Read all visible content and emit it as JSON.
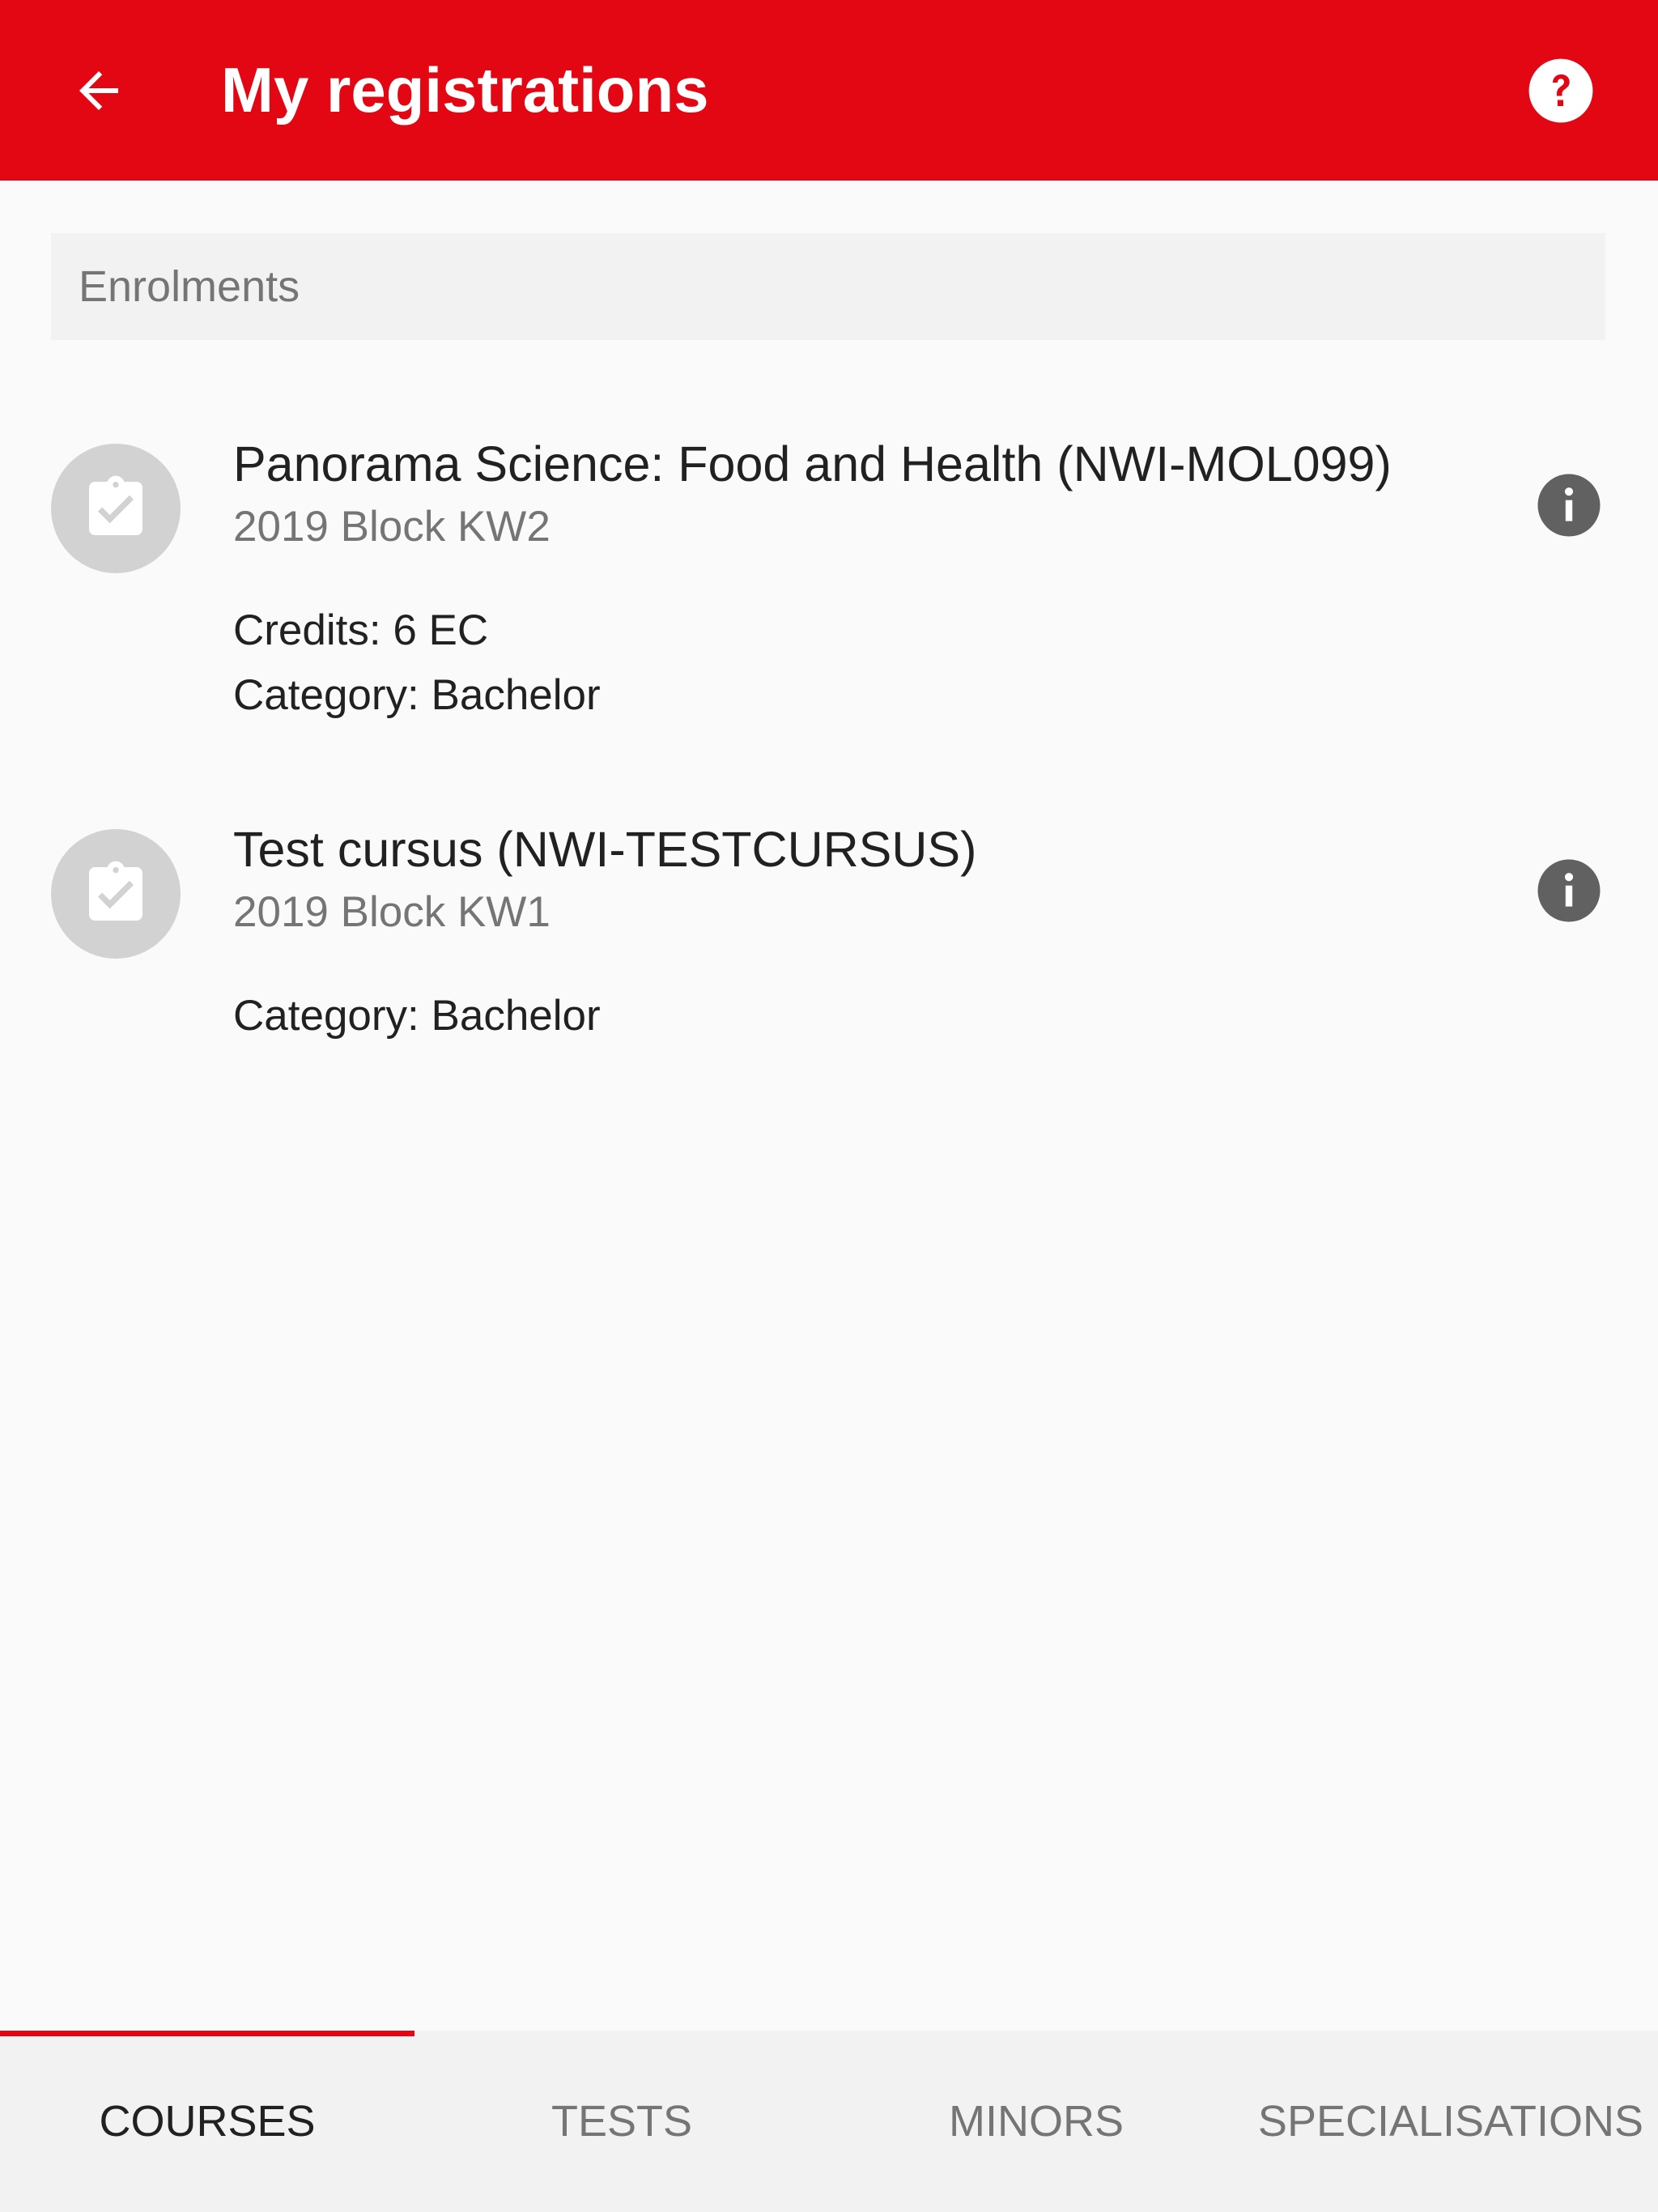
{
  "header": {
    "title": "My registrations",
    "back_icon": "arrow-left-icon",
    "help_icon": "help-circle-icon",
    "background_color": "#e30613"
  },
  "section": {
    "label": "Enrolments"
  },
  "items": [
    {
      "title": "Panorama Science: Food and Health (NWI-MOL099)",
      "subtitle": "2019 Block KW2",
      "details": [
        "Credits: 6 EC",
        "Category: Bachelor"
      ],
      "icon": "clipboard-check-icon",
      "info_icon": "info-icon"
    },
    {
      "title": "Test cursus (NWI-TESTCURSUS)",
      "subtitle": "2019 Block KW1",
      "details": [
        "Category: Bachelor"
      ],
      "icon": "clipboard-check-icon",
      "info_icon": "info-icon"
    }
  ],
  "tabs": [
    {
      "label": "COURSES",
      "active": true
    },
    {
      "label": "TESTS",
      "active": false
    },
    {
      "label": "MINORS",
      "active": false
    },
    {
      "label": "SPECIALISATIONS",
      "active": false
    }
  ],
  "colors": {
    "accent": "#e30613",
    "text_primary": "#212121",
    "text_secondary": "#757575",
    "avatar_bg": "#d2d2d2",
    "info_icon": "#616161"
  }
}
